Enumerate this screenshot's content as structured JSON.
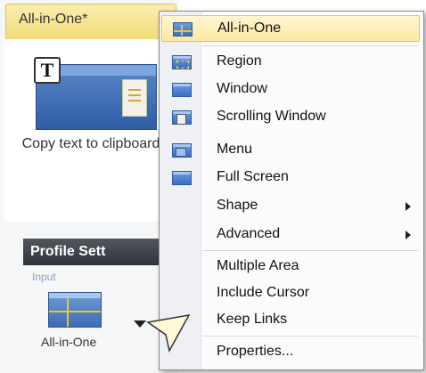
{
  "app": {
    "top_tab_label": "All-in-One*"
  },
  "card": {
    "badge_letter": "T",
    "copy_label": "Copy text to clipboard"
  },
  "profile": {
    "header": "Profile Sett",
    "input_label": "Input",
    "input_value": "All-in-One"
  },
  "menu": {
    "items": [
      {
        "label": "All-in-One",
        "icon": "all-in-one-icon",
        "selected": true
      },
      {
        "label": "Region",
        "icon": "region-icon"
      },
      {
        "label": "Window",
        "icon": "window-icon"
      },
      {
        "label": "Scrolling Window",
        "icon": "scrolling-window-icon"
      },
      {
        "label": "Menu",
        "icon": "menu-icon"
      },
      {
        "label": "Full Screen",
        "icon": "full-screen-icon"
      },
      {
        "label": "Shape",
        "submenu": true
      },
      {
        "label": "Advanced",
        "submenu": true
      },
      {
        "label": "Multiple Area"
      },
      {
        "label": "Include Cursor"
      },
      {
        "label": "Keep Links"
      },
      {
        "label": "Properties..."
      }
    ]
  },
  "colors": {
    "accent": "#f4dc79",
    "selection": "#fde7a2",
    "header_bg": "#30343a"
  }
}
